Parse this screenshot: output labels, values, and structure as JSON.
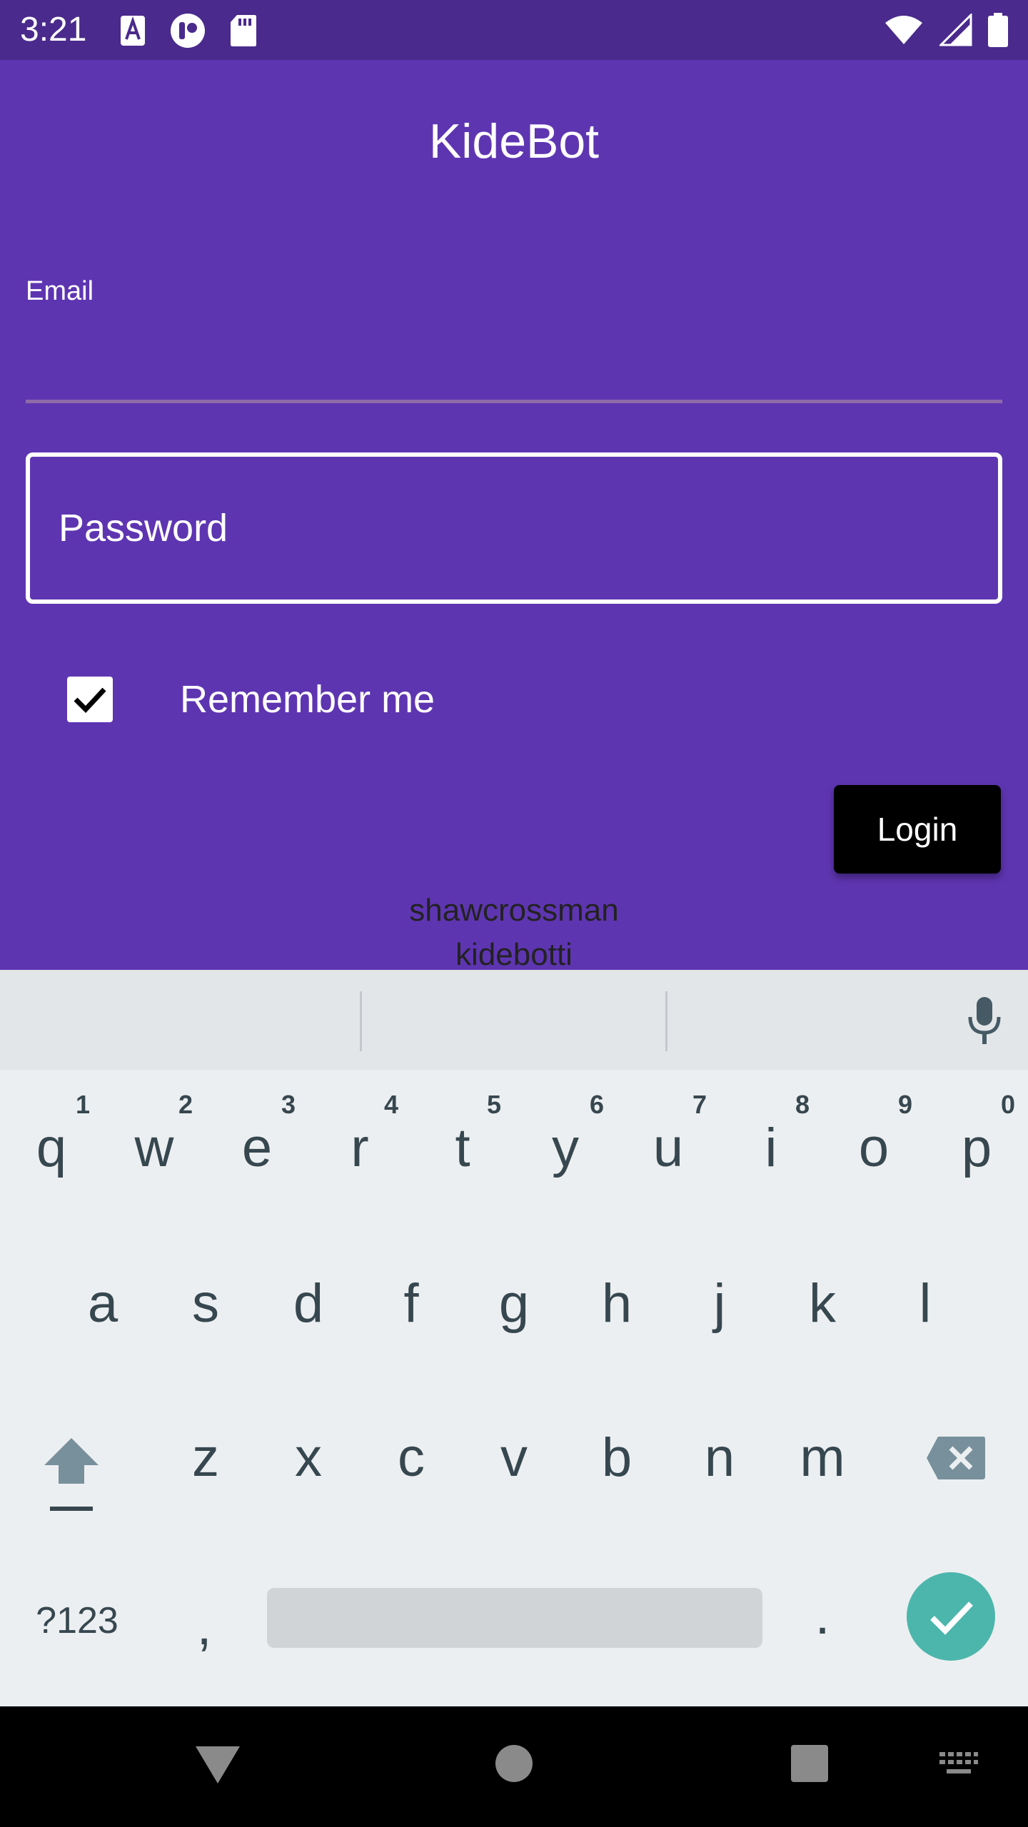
{
  "status_bar": {
    "time": "3:21",
    "left_icons": [
      "font-icon",
      "app-icon",
      "sd-card-icon"
    ],
    "right_icons": [
      "wifi-icon",
      "cell-signal-icon",
      "battery-icon"
    ]
  },
  "app": {
    "title": "KideBot",
    "email": {
      "label": "Email",
      "value": ""
    },
    "password": {
      "placeholder": "Password"
    },
    "remember_me": {
      "label": "Remember me",
      "checked": true
    },
    "login_label": "Login",
    "footer_lines": [
      "shawcrossman",
      "kidebotti"
    ],
    "colors": {
      "background": "#5e35b1",
      "button": "#000000",
      "status_bar": "#4a2a8c"
    }
  },
  "keyboard": {
    "row1": [
      "q",
      "w",
      "e",
      "r",
      "t",
      "y",
      "u",
      "i",
      "o",
      "p"
    ],
    "row1_hints": [
      "1",
      "2",
      "3",
      "4",
      "5",
      "6",
      "7",
      "8",
      "9",
      "0"
    ],
    "row2": [
      "a",
      "s",
      "d",
      "f",
      "g",
      "h",
      "j",
      "k",
      "l"
    ],
    "row3": [
      "z",
      "x",
      "c",
      "v",
      "b",
      "n",
      "m"
    ],
    "symbols_label": "?123",
    "comma": ",",
    "period": ".",
    "enter_color": "#4db6ac"
  },
  "nav_bar": {
    "icons": [
      "back-icon",
      "home-icon",
      "recents-icon",
      "keyboard-switch-icon"
    ]
  }
}
